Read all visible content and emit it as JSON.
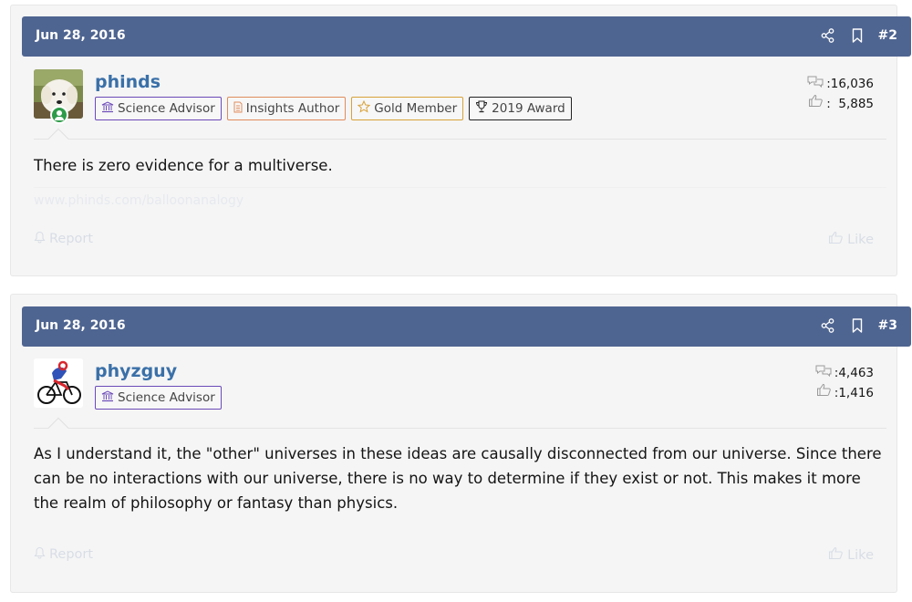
{
  "posts": [
    {
      "date": "Jun 28, 2016",
      "number": "#2",
      "username": "phinds",
      "badges": [
        "Science Advisor",
        "Insights Author",
        "Gold Member",
        "2019 Award"
      ],
      "messages_count": ":16,036",
      "likes_count": ":  5,885",
      "body": "There is zero evidence for a multiverse.",
      "signature_link": "www.phinds.com/balloonanalogy",
      "report_label": "Report",
      "like_label": "Like"
    },
    {
      "date": "Jun 28, 2016",
      "number": "#3",
      "username": "phyzguy",
      "badges": [
        "Science Advisor"
      ],
      "messages_count": ":4,463",
      "likes_count": ":1,416",
      "body": "As I understand it, the \"other\" universes in these ideas are causally disconnected from our universe. Since there can be no interactions with our universe, there is no way to determine if they exist or not. This makes it more the realm of philosophy or fantasy than physics.",
      "report_label": "Report",
      "like_label": "Like"
    }
  ],
  "colors": {
    "header_bg": "#4f6591",
    "username": "#3a70a8",
    "badge_science": "#6b4ab8",
    "badge_insights": "#e08c5c",
    "badge_gold": "#d8a23a",
    "badge_award": "#222222",
    "online": "#2e9b49"
  },
  "icons": [
    "share-icon",
    "bookmark-icon",
    "messages-icon",
    "likes-icon",
    "bell-icon",
    "thumbs-up-icon",
    "institution-icon",
    "document-icon",
    "star-icon",
    "trophy-icon"
  ]
}
